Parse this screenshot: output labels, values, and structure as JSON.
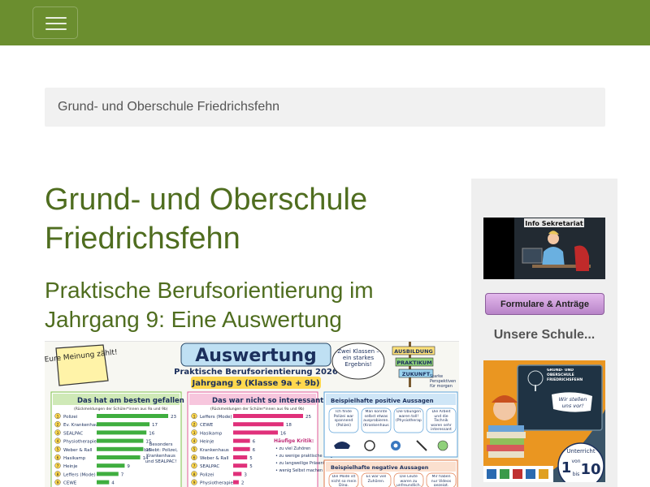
{
  "breadcrumb": {
    "label": "Grund- und Oberschule Friedrichsfehn"
  },
  "page": {
    "title": "Grund- und Oberschule Friedrichsfehn"
  },
  "article": {
    "title": "Praktische Berufsorientierung im Jahrgang 9: Eine Auswertung"
  },
  "poster": {
    "badge": "Eure Meinung zählt!",
    "title": "Auswertung",
    "subtitle": "Praktische Berufsorientierung 2026",
    "grade": "Jahrgang 9 (Klasse 9a + 9b)",
    "bubble": "Zwei Klassen – ein starkes Ergebnis!",
    "signs": [
      "AUSBILDUNG",
      "PRAKTIKUM",
      "ZUKUNFT"
    ],
    "sign_note": "Starke Perspektiven für morgen",
    "sections": {
      "best": "Das hat am besten gefallen",
      "best_note": "(Rückmeldungen der Schüler*innen aus 9a und 9b)",
      "worst": "Das war nicht so interessant",
      "worst_note": "(Rückmeldungen der Schüler*innen aus 9a und 9b)",
      "positive": "Beispielhafte positive Aussagen",
      "negative": "Beispielhafte negative Aussagen"
    },
    "best_items": [
      {
        "rank": "1",
        "label": "Polizei",
        "value": 23
      },
      {
        "rank": "2",
        "label": "Ev. Krankenhaus",
        "value": 17
      },
      {
        "rank": "3",
        "label": "SEALPAC",
        "value": 16
      },
      {
        "rank": "4",
        "label": "Physiotherapie",
        "value": 15
      },
      {
        "rank": "5",
        "label": "Weber & Rall",
        "value": 15
      },
      {
        "rank": "6",
        "label": "Hasikamp",
        "value": 14
      },
      {
        "rank": "7",
        "label": "Heinje",
        "value": 9
      },
      {
        "rank": "8",
        "label": "Leffers (Mode)",
        "value": 7
      },
      {
        "rank": "9",
        "label": "CEWE",
        "value": 4
      }
    ],
    "worst_items": [
      {
        "rank": "1",
        "label": "Leffers (Mode)",
        "value": 25
      },
      {
        "rank": "2",
        "label": "CEWE",
        "value": 18
      },
      {
        "rank": "3",
        "label": "Hasikamp",
        "value": 16
      },
      {
        "rank": "4",
        "label": "Heinje",
        "value": 6
      },
      {
        "rank": "5",
        "label": "Krankenhaus",
        "value": 6
      },
      {
        "rank": "6",
        "label": "Weber & Rall",
        "value": 5
      },
      {
        "rank": "7",
        "label": "SEALPAC",
        "value": 5
      },
      {
        "rank": "8",
        "label": "Polizei",
        "value": 3
      },
      {
        "rank": "9",
        "label": "Physiotherapie",
        "value": 2
      }
    ],
    "highlight_note": "Besonders beliebt: Polizei, Krankenhaus und SEALPAC!",
    "critique_title": "Häufige Kritik:",
    "critique_items": [
      "zu viel Zuhören",
      "zu wenige praktische Aufgaben",
      "zu langweilige Präsentationen",
      "wenig Selbst machen"
    ],
    "positive_quotes": [
      "Ich finde Polizei war spannend (Polizei)",
      "Man konnte selbst etwas ausprobieren. (Krankenhaus)",
      "Die Übungen waren toll! (Physiotherapie)",
      "Die Arbeit und die Technik waren sehr interessant (SEALPAC)"
    ],
    "negative_quotes": [
      "Die Mode ist nicht so mein Ding.",
      "Es war viel Zuhören.",
      "Die Leute waren zu unfreundlich.",
      "Mir haben nur Videos gezeigt."
    ]
  },
  "sidebar": {
    "info_banner_label": "Info Sekretariat",
    "forms_button_label": "Formulare & Anträge",
    "heading": "Unsere Schule...",
    "school_banner": {
      "title": "GRUND- UND OBERSCHULE FRIEDRICHSFEHN",
      "slogan": "Wir stellen uns vor!",
      "badge_top": "Unterricht",
      "badge_from": "1",
      "badge_mid": "von",
      "badge_to": "10",
      "badge_bottom": "bis"
    }
  },
  "colors": {
    "navbar": "#6b8e2f",
    "heading": "#4f6d1f",
    "sidebar_bg": "#efefef",
    "breadcrumb_bg": "#f1f1f1"
  }
}
